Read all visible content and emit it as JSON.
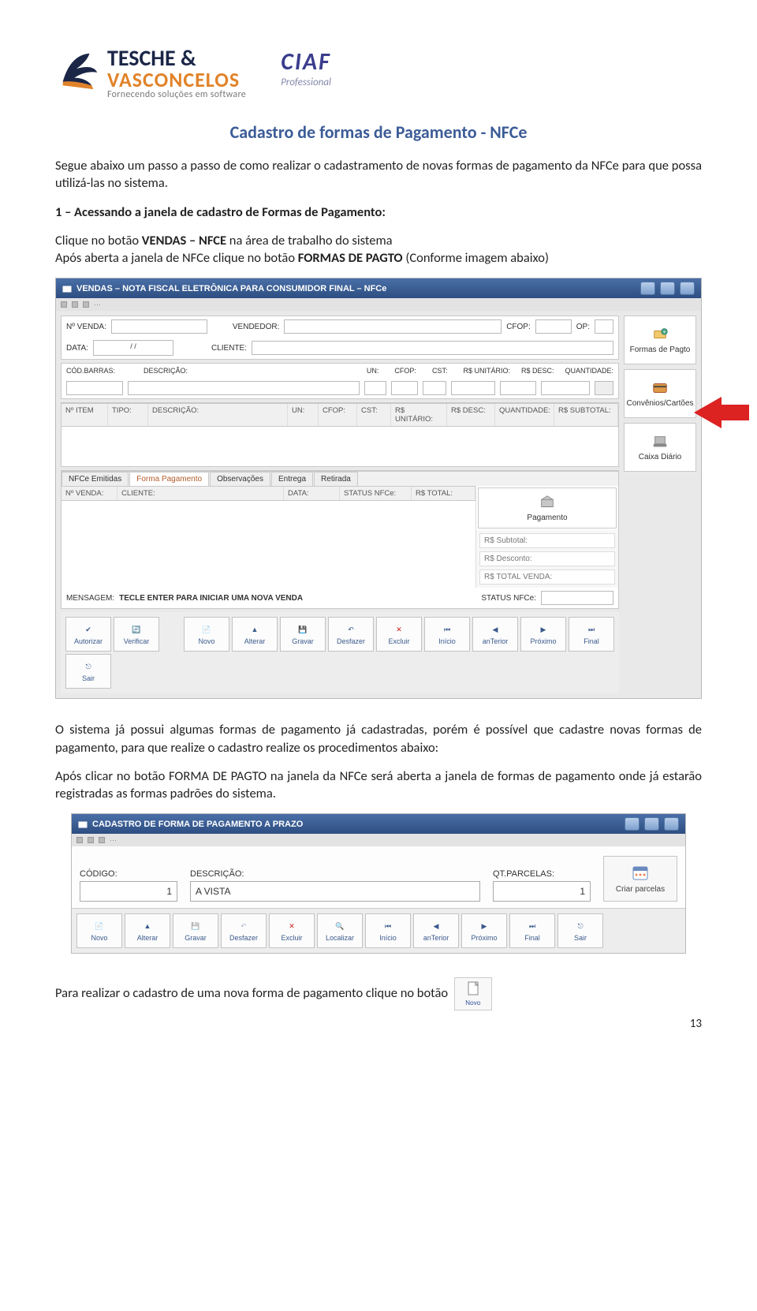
{
  "header": {
    "tv_line1": "TESCHE &",
    "tv_line2": "VASCONCELOS",
    "tv_tagline": "Fornecendo soluções em software",
    "ciaf": "CIAF",
    "ciaf_sub": "Professional"
  },
  "title": "Cadastro de formas de Pagamento - NFCe",
  "p1": "Segue abaixo um passo a passo de como realizar o cadastramento de novas formas de pagamento da NFCe para que possa utilizá-las no sistema.",
  "h2": "1 – Acessando a janela de cadastro de Formas de Pagamento:",
  "p2a": "Clique no botão ",
  "p2b": "VENDAS – NFCE",
  "p2c": " na área de trabalho do sistema",
  "p3a": "Após aberta a janela de NFCe clique no botão ",
  "p3b": "FORMAS DE PAGTO",
  "p3c": " (Conforme imagem abaixo)",
  "s1": {
    "title": "VENDAS – NOTA FISCAL ELETRÔNICA PARA CONSUMIDOR FINAL – NFCe",
    "nvenda": "Nº VENDA:",
    "vendedor": "VENDEDOR:",
    "cfop": "CFOP:",
    "op": "OP:",
    "data": "DATA:",
    "data_val": "/        /",
    "cliente": "CLIENTE:",
    "codbarras": "CÓD.BARRAS:",
    "descricao": "DESCRIÇÃO:",
    "un": "UN:",
    "cfop2": "CFOP:",
    "cst": "CST:",
    "runit": "R$ UNITÁRIO:",
    "rdesc": "R$ DESC:",
    "quant": "QUANTIDADE:",
    "nitem": "Nº ITEM",
    "tipo": "TIPO:",
    "desc2": "DESCRIÇÃO:",
    "rsubtotal": "R$ SUBTOTAL:",
    "tabs": [
      "NFCe Emitidas",
      "Forma Pagamento",
      "Observações",
      "Entrega",
      "Retirada"
    ],
    "gridcols": [
      "Nº VENDA:",
      "CLIENTE:",
      "DATA:",
      "STATUS NFCe:",
      "R$ TOTAL:"
    ],
    "mensagem_lbl": "MENSAGEM:",
    "mensagem_txt": "TECLE ENTER PARA INICIAR UMA NOVA VENDA",
    "status": "STATUS NFCe:",
    "side": {
      "formas": "Formas de Pagto",
      "convenios": "Convênios/Cartões",
      "caixa": "Caixa Diário",
      "pagamento": "Pagamento"
    },
    "totals": {
      "sub": "R$ Subtotal:",
      "desc": "R$ Desconto:",
      "total": "R$ TOTAL VENDA:"
    },
    "toolbar": [
      "Autorizar",
      "Verificar",
      "Novo",
      "Alterar",
      "Gravar",
      "Desfazer",
      "Excluir",
      "Início",
      "anTerior",
      "Próximo",
      "Final",
      "Sair"
    ]
  },
  "p4": "O sistema já possui algumas formas de pagamento já cadastradas, porém é possível que cadastre novas formas de pagamento, para que realize o cadastro realize os procedimentos abaixo:",
  "p5": "Após clicar no botão FORMA DE PAGTO na janela da NFCe será aberta a janela de formas de pagamento onde já estarão registradas as formas padrões do sistema.",
  "s2": {
    "title": "CADASTRO DE FORMA DE PAGAMENTO A PRAZO",
    "codigo_lbl": "CÓDIGO:",
    "codigo_val": "1",
    "desc_lbl": "DESCRIÇÃO:",
    "desc_val": "A VISTA",
    "qt_lbl": "QT.PARCELAS:",
    "qt_val": "1",
    "criar": "Criar parcelas",
    "toolbar": [
      "Novo",
      "Alterar",
      "Gravar",
      "Desfazer",
      "Excluir",
      "Localizar",
      "Início",
      "anTerior",
      "Próximo",
      "Final",
      "Sair"
    ]
  },
  "p6a": "Para realizar o cadastro de uma nova forma de pagamento clique no botão ",
  "p6_btn": "Novo",
  "pagenum": "13"
}
